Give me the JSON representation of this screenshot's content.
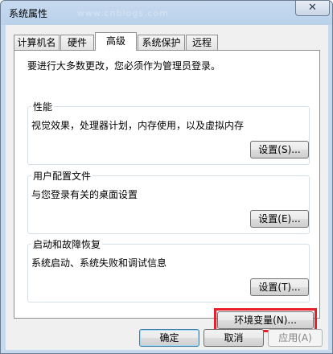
{
  "window": {
    "title": "系统属性",
    "watermark": "www.cnblogs.com"
  },
  "tabs": [
    {
      "label": "计算机名"
    },
    {
      "label": "硬件"
    },
    {
      "label": "高级",
      "active": true
    },
    {
      "label": "系统保护"
    },
    {
      "label": "远程"
    }
  ],
  "advanced": {
    "admin_note": "要进行大多数更改，您必须作为管理员登录。",
    "performance": {
      "title": "性能",
      "description": "视觉效果，处理器计划，内存使用，以及虚拟内存",
      "button": "设置(S)..."
    },
    "user_profiles": {
      "title": "用户配置文件",
      "description": "与您登录有关的桌面设置",
      "button": "设置(E)..."
    },
    "startup_recovery": {
      "title": "启动和故障恢复",
      "description": "系统启动、系统失败和调试信息",
      "button": "设置(T)..."
    },
    "env_button": "环境变量(N)..."
  },
  "footer": {
    "ok": "确定",
    "cancel": "取消",
    "apply": "应用(A)"
  },
  "colors": {
    "highlight_border": "#e8202a",
    "panel_background": "#ffffff",
    "dialog_background": "#f0f0f0"
  }
}
